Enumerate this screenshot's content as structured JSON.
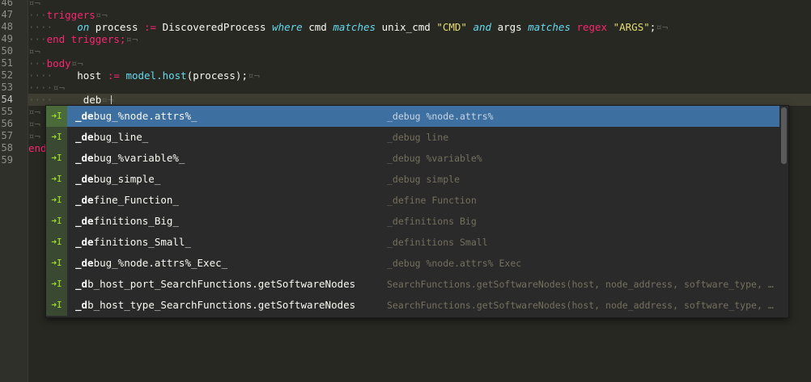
{
  "gutter": {
    "line_numbers": [
      "46",
      "47",
      "48",
      "49",
      "50",
      "51",
      "52",
      "53",
      "54",
      "55",
      "56",
      "57",
      "58",
      "59"
    ]
  },
  "code": {
    "l47": {
      "kw": "triggers",
      "ws": "¤¬"
    },
    "l48": {
      "kw1": "on",
      "t1": " process ",
      "op": ":=",
      "t2": " DiscoveredProcess ",
      "kw2": "where",
      "t3": " cmd ",
      "kw3": "matches",
      "t4": " unix_cmd ",
      "str1": "\"CMD\"",
      "t5": " ",
      "kw4": "and",
      "t6": " args ",
      "kw5": "matches",
      "t7": " ",
      "kw6": "regex",
      "t8": " ",
      "str2": "\"ARGS\"",
      "t9": ";",
      "ws": "¤¬"
    },
    "l49": {
      "kw": "end triggers;",
      "ws": "¤¬"
    },
    "l51": {
      "kw": "body",
      "ws": "¤¬"
    },
    "l52": {
      "t1": "host ",
      "op": ":=",
      "fn": " model.host",
      "t2": "(process);",
      "ws": "¤¬"
    },
    "l54": {
      "t1": "_deb",
      "ws": "¤¬"
    },
    "l58": {
      "kw": "end"
    }
  },
  "autocomplete": {
    "items": [
      {
        "match": "_de",
        "rest": "bug_%node.attrs%_",
        "desc": "_debug %node.attrs%"
      },
      {
        "match": "_de",
        "rest": "bug_line_",
        "desc": "_debug line"
      },
      {
        "match": "_de",
        "rest": "bug_%variable%_",
        "desc": "_debug %variable%"
      },
      {
        "match": "_de",
        "rest": "bug_simple_",
        "desc": "_debug simple"
      },
      {
        "match": "_de",
        "rest": "fine_Function_",
        "desc": "_define Function"
      },
      {
        "match": "_de",
        "rest": "finitions_Big_",
        "desc": "_definitions Big"
      },
      {
        "match": "_de",
        "rest": "finitions_Small_",
        "desc": "_definitions Small"
      },
      {
        "match": "_de",
        "rest": "bug_%node.attrs%_Exec_",
        "desc": "_debug %node.attrs% Exec"
      },
      {
        "match": "_d",
        "rest": "b_host_port_SearchFunctions.getSoftwareNodes",
        "desc": "SearchFunctions.getSoftwareNodes(host, node_address, software_type, port,…"
      },
      {
        "match": "_d",
        "rest": "b_host_type_SearchFunctions.getSoftwareNodes",
        "desc": "SearchFunctions.getSoftwareNodes(host, node_address, software_type, db_na…"
      }
    ],
    "kind_icon": "snippet-icon",
    "kind_glyph": "➜I"
  }
}
